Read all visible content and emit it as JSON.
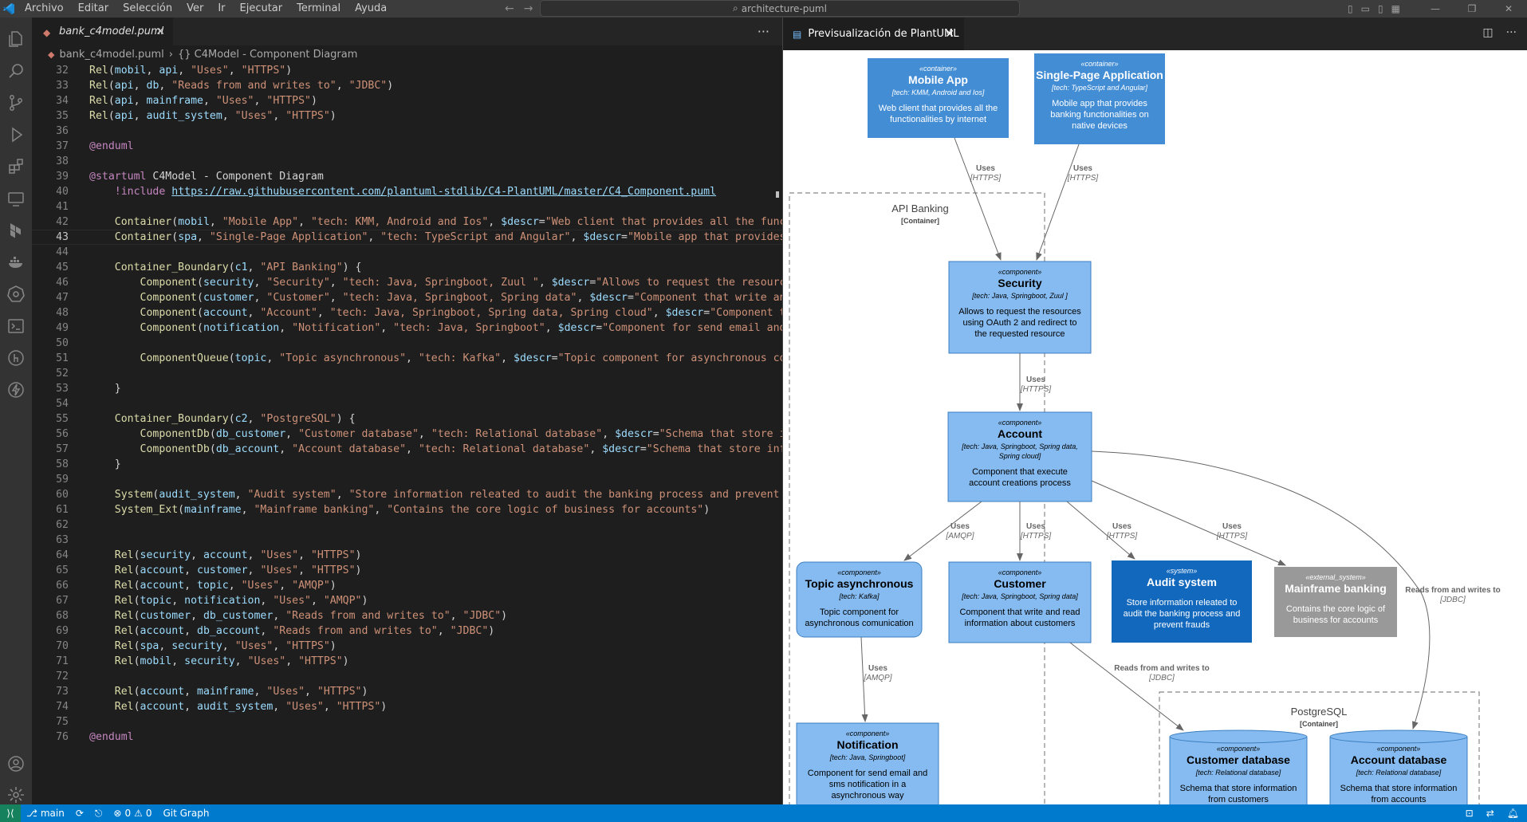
{
  "titlebar": {
    "menu": [
      "Archivo",
      "Editar",
      "Selección",
      "Ver",
      "Ir",
      "Ejecutar",
      "Terminal",
      "Ayuda"
    ],
    "search": "architecture-puml"
  },
  "editor": {
    "tab_label": "bank_c4model.puml",
    "breadcrumb_file": "bank_c4model.puml",
    "breadcrumb_symbol": "{} C4Model - Component Diagram",
    "current_line": 43,
    "lines": [
      {
        "n": 32,
        "t": "Rel(mobil, api, \"Uses\", \"HTTPS\")"
      },
      {
        "n": 33,
        "t": "Rel(api, db, \"Reads from and writes to\", \"JDBC\")"
      },
      {
        "n": 34,
        "t": "Rel(api, mainframe, \"Uses\", \"HTTPS\")"
      },
      {
        "n": 35,
        "t": "Rel(api, audit_system, \"Uses\", \"HTTPS\")"
      },
      {
        "n": 36,
        "t": ""
      },
      {
        "n": 37,
        "t": "@enduml"
      },
      {
        "n": 38,
        "t": ""
      },
      {
        "n": 39,
        "t": "@startuml C4Model - Component Diagram"
      },
      {
        "n": 40,
        "t": "    !include https://raw.githubusercontent.com/plantuml-stdlib/C4-PlantUML/master/C4_Component.puml"
      },
      {
        "n": 41,
        "t": ""
      },
      {
        "n": 42,
        "t": "    Container(mobil, \"Mobile App\", \"tech: KMM, Android and Ios\", $descr=\"Web client that provides all the functic"
      },
      {
        "n": 43,
        "t": "    Container(spa, \"Single-Page Application\", \"tech: TypeScript and Angular\", $descr=\"Mobile app that provides ba"
      },
      {
        "n": 44,
        "t": ""
      },
      {
        "n": 45,
        "t": "    Container_Boundary(c1, \"API Banking\") {"
      },
      {
        "n": 46,
        "t": "        Component(security, \"Security\", \"tech: Java, Springboot, Zuul \", $descr=\"Allows to request the resources"
      },
      {
        "n": 47,
        "t": "        Component(customer, \"Customer\", \"tech: Java, Springboot, Spring data\", $descr=\"Component that write and r"
      },
      {
        "n": 48,
        "t": "        Component(account, \"Account\", \"tech: Java, Springboot, Spring data, Spring cloud\", $descr=\"Component that"
      },
      {
        "n": 49,
        "t": "        Component(notification, \"Notification\", \"tech: Java, Springboot\", $descr=\"Component for send email and sm"
      },
      {
        "n": 50,
        "t": ""
      },
      {
        "n": 51,
        "t": "        ComponentQueue(topic, \"Topic asynchronous\", \"tech: Kafka\", $descr=\"Topic component for asynchronous comur"
      },
      {
        "n": 52,
        "t": ""
      },
      {
        "n": 53,
        "t": "    }"
      },
      {
        "n": 54,
        "t": ""
      },
      {
        "n": 55,
        "t": "    Container_Boundary(c2, \"PostgreSQL\") {"
      },
      {
        "n": 56,
        "t": "        ComponentDb(db_customer, \"Customer database\", \"tech: Relational database\", $descr=\"Schema that store info"
      },
      {
        "n": 57,
        "t": "        ComponentDb(db_account, \"Account database\", \"tech: Relational database\", $descr=\"Schema that store inform"
      },
      {
        "n": 58,
        "t": "    }"
      },
      {
        "n": 59,
        "t": ""
      },
      {
        "n": 60,
        "t": "    System(audit_system, \"Audit system\", \"Store information releated to audit the banking process and prevent fra"
      },
      {
        "n": 61,
        "t": "    System_Ext(mainframe, \"Mainframe banking\", \"Contains the core logic of business for accounts\")"
      },
      {
        "n": 62,
        "t": ""
      },
      {
        "n": 63,
        "t": ""
      },
      {
        "n": 64,
        "t": "    Rel(security, account, \"Uses\", \"HTTPS\")"
      },
      {
        "n": 65,
        "t": "    Rel(account, customer, \"Uses\", \"HTTPS\")"
      },
      {
        "n": 66,
        "t": "    Rel(account, topic, \"Uses\", \"AMQP\")"
      },
      {
        "n": 67,
        "t": "    Rel(topic, notification, \"Uses\", \"AMQP\")"
      },
      {
        "n": 68,
        "t": "    Rel(customer, db_customer, \"Reads from and writes to\", \"JDBC\")"
      },
      {
        "n": 69,
        "t": "    Rel(account, db_account, \"Reads from and writes to\", \"JDBC\")"
      },
      {
        "n": 70,
        "t": "    Rel(spa, security, \"Uses\", \"HTTPS\")"
      },
      {
        "n": 71,
        "t": "    Rel(mobil, security, \"Uses\", \"HTTPS\")"
      },
      {
        "n": 72,
        "t": ""
      },
      {
        "n": 73,
        "t": "    Rel(account, mainframe, \"Uses\", \"HTTPS\")"
      },
      {
        "n": 74,
        "t": "    Rel(account, audit_system, \"Uses\", \"HTTPS\")"
      },
      {
        "n": 75,
        "t": ""
      },
      {
        "n": 76,
        "t": "@enduml"
      }
    ]
  },
  "preview": {
    "tab_label": "Previsualización de PlantUML",
    "boundaries": [
      {
        "id": "api",
        "title": "API Banking",
        "kind": "[Container]"
      },
      {
        "id": "pg",
        "title": "PostgreSQL",
        "kind": "[Container]"
      }
    ],
    "nodes": [
      {
        "id": "mobile",
        "stereo": "«container»",
        "title": "Mobile App",
        "tech": "[tech: KMM, Android and Ios]",
        "desc": [
          "Web client that provides all the",
          "functionalities by internet"
        ]
      },
      {
        "id": "spa",
        "stereo": "«container»",
        "title": "Single-Page Application",
        "tech": "[tech: TypeScript and Angular]",
        "desc": [
          "Mobile app that provides",
          "banking functionalities on",
          "native devices"
        ]
      },
      {
        "id": "security",
        "stereo": "«component»",
        "title": "Security",
        "tech": "[tech: Java, Springboot, Zuul ]",
        "desc": [
          "Allows to request the resources",
          "using OAuth 2 and redirect to",
          "the requested resource"
        ]
      },
      {
        "id": "account",
        "stereo": "«component»",
        "title": "Account",
        "tech": "[tech: Java, Springboot, Spring data,",
        "tech2": "Spring cloud]",
        "desc": [
          "Component that execute",
          "account creations process"
        ]
      },
      {
        "id": "topic",
        "stereo": "«component»",
        "title": "Topic asynchronous",
        "tech": "[tech: Kafka]",
        "desc": [
          "Topic component for",
          "asynchronous comunication"
        ]
      },
      {
        "id": "customer",
        "stereo": "«component»",
        "title": "Customer",
        "tech": "[tech: Java, Springboot, Spring data]",
        "desc": [
          "Component that write and read",
          "information about customers"
        ]
      },
      {
        "id": "audit",
        "stereo": "«system»",
        "title": "Audit system",
        "desc": [
          "Store information releated to",
          "audit the banking process and",
          "prevent frauds"
        ]
      },
      {
        "id": "mainframe",
        "stereo": "«external_system»",
        "title": "Mainframe banking",
        "desc": [
          "Contains the core logic of",
          "business for accounts"
        ]
      },
      {
        "id": "notification",
        "stereo": "«component»",
        "title": "Notification",
        "tech": "[tech: Java, Springboot]",
        "desc": [
          "Component for send email and",
          "sms notification in a",
          "asynchronous way"
        ]
      },
      {
        "id": "dbcustomer",
        "stereo": "«component»",
        "title": "Customer database",
        "tech": "[tech: Relational database]",
        "desc": [
          "Schema that store information",
          "from customers"
        ]
      },
      {
        "id": "dbaccount",
        "stereo": "«component»",
        "title": "Account database",
        "tech": "[tech: Relational database]",
        "desc": [
          "Schema that store information",
          "from accounts"
        ]
      }
    ],
    "edges": [
      {
        "id": "mobile-security",
        "label": "Uses",
        "proto": "[HTTPS]"
      },
      {
        "id": "spa-security",
        "label": "Uses",
        "proto": "[HTTPS]"
      },
      {
        "id": "security-account",
        "label": "Uses",
        "proto": "[HTTPS]"
      },
      {
        "id": "account-topic",
        "label": "Uses",
        "proto": "[AMQP]"
      },
      {
        "id": "account-customer",
        "label": "Uses",
        "proto": "[HTTPS]"
      },
      {
        "id": "account-audit",
        "label": "Uses",
        "proto": "[HTTPS]"
      },
      {
        "id": "account-mainframe",
        "label": "Uses",
        "proto": "[HTTPS]"
      },
      {
        "id": "account-dbaccount",
        "label": "Reads from and writes to",
        "proto": "[JDBC]"
      },
      {
        "id": "topic-notification",
        "label": "Uses",
        "proto": "[AMQP]"
      },
      {
        "id": "customer-dbcustomer",
        "label": "Reads from and writes to",
        "proto": "[JDBC]"
      }
    ]
  },
  "statusbar": {
    "branch": "main",
    "errors": "0",
    "warnings": "0",
    "git_graph": "Git Graph"
  },
  "colors": {
    "accent": "#007acc",
    "container": "#438dd5",
    "component": "#85bbf0",
    "system": "#1168bd",
    "external_system": "#999999"
  }
}
